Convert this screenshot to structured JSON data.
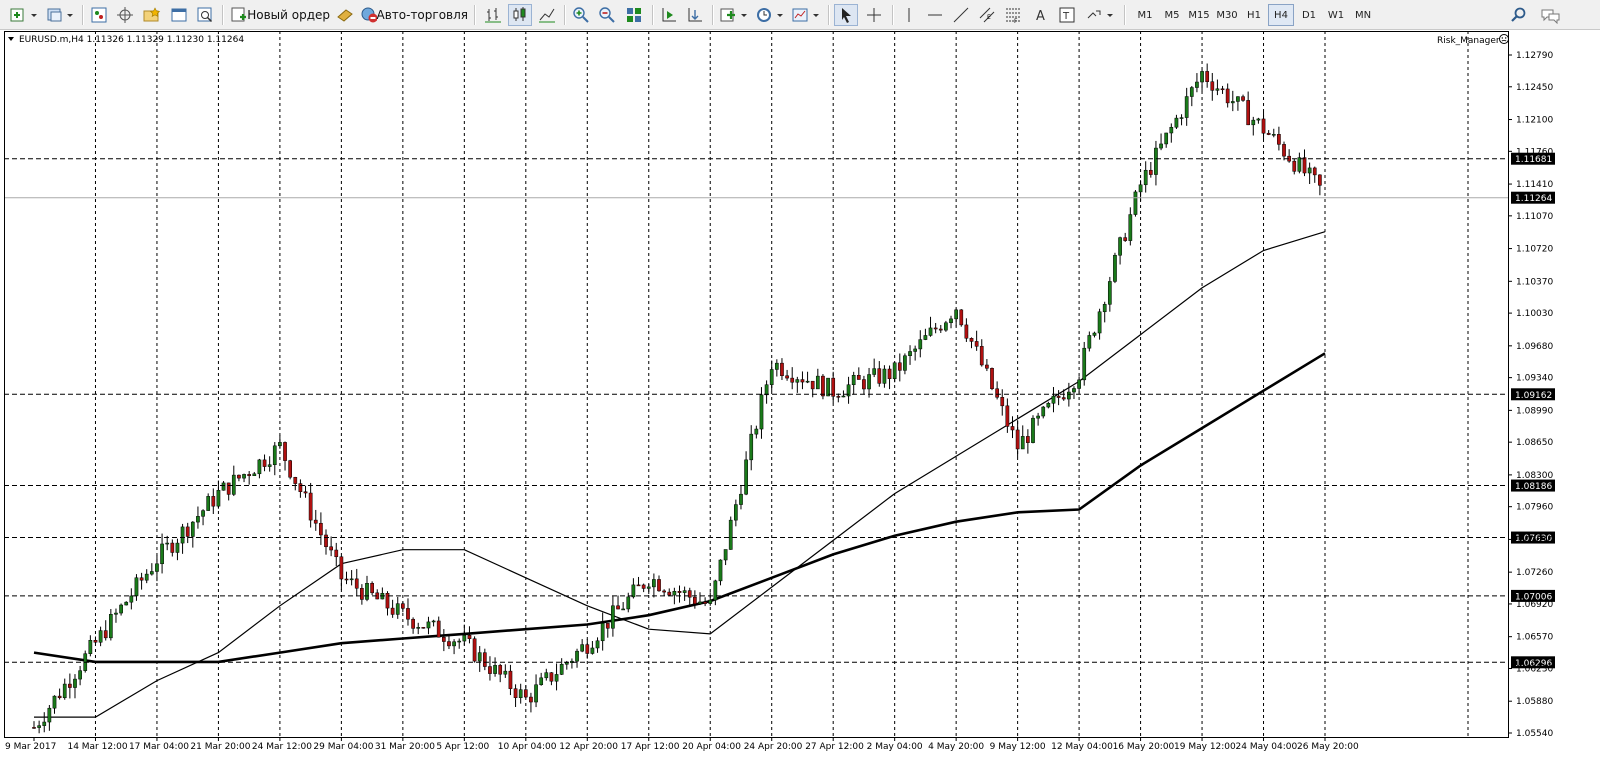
{
  "toolbar": {
    "new_order_label": "Новый ордер",
    "autotrading_label": "Авто-торговля",
    "timeframes": [
      "M1",
      "M5",
      "M15",
      "M30",
      "H1",
      "H4",
      "D1",
      "W1",
      "MN"
    ],
    "active_timeframe": "H4"
  },
  "chart": {
    "header": "EURUSD.m,H4  1.11326 1.11329 1.11230 1.11264",
    "indicator_label": "Risk_Manager",
    "price_ticks": [
      "1.12790",
      "1.12450",
      "1.12100",
      "1.11760",
      "1.11410",
      "1.11070",
      "1.10720",
      "1.10370",
      "1.10030",
      "1.09680",
      "1.09340",
      "1.08990",
      "1.08650",
      "1.08300",
      "1.07960",
      "1.07610",
      "1.07260",
      "1.06920",
      "1.06570",
      "1.06230",
      "1.05880",
      "1.05540"
    ],
    "time_labels": [
      "9 Mar 2017",
      "14 Mar 12:00",
      "17 Mar 04:00",
      "21 Mar 20:00",
      "24 Mar 12:00",
      "29 Mar 04:00",
      "31 Mar 20:00",
      "5 Apr 12:00",
      "10 Apr 04:00",
      "12 Apr 20:00",
      "17 Apr 12:00",
      "20 Apr 04:00",
      "24 Apr 20:00",
      "27 Apr 12:00",
      "2 May 04:00",
      "4 May 20:00",
      "9 May 12:00",
      "12 May 04:00",
      "16 May 20:00",
      "19 May 12:00",
      "24 May 04:00",
      "26 May 20:00"
    ],
    "levels": [
      {
        "label": "1.11681",
        "value": 1.11681
      },
      {
        "label": "1.09162",
        "value": 1.09162
      },
      {
        "label": "1.08186",
        "value": 1.08186
      },
      {
        "label": "1.07630",
        "value": 1.0763
      },
      {
        "label": "1.07006",
        "value": 1.07006
      },
      {
        "label": "1.06296",
        "value": 1.06296
      }
    ],
    "bid": {
      "label": "1.11264",
      "value": 1.11264
    },
    "colors": {
      "bull": "#1a7a1a",
      "bear": "#b01010",
      "line": "#000000"
    }
  },
  "chart_data": {
    "type": "line",
    "title": "EURUSD.m,H4",
    "ylim": [
      1.0554,
      1.1284
    ],
    "x": [
      "9 Mar 2017",
      "14 Mar 12:00",
      "17 Mar 04:00",
      "21 Mar 20:00",
      "24 Mar 12:00",
      "29 Mar 04:00",
      "31 Mar 20:00",
      "5 Apr 12:00",
      "10 Apr 04:00",
      "12 Apr 20:00",
      "17 Apr 12:00",
      "20 Apr 04:00",
      "24 Apr 20:00",
      "27 Apr 12:00",
      "2 May 04:00",
      "4 May 20:00",
      "9 May 12:00",
      "12 May 04:00",
      "16 May 20:00",
      "19 May 12:00",
      "24 May 04:00",
      "26 May 20:00"
    ],
    "series": [
      {
        "name": "EURUSD.m",
        "values": [
          1.056,
          1.065,
          1.074,
          1.081,
          1.086,
          1.072,
          1.068,
          1.065,
          1.059,
          1.065,
          1.072,
          1.069,
          1.095,
          1.092,
          1.094,
          1.101,
          1.086,
          1.094,
          1.114,
          1.126,
          1.12,
          1.113
        ]
      },
      {
        "values": [
          1.0571,
          1.0571,
          1.061,
          1.064,
          1.069,
          1.0735,
          1.075,
          1.075,
          1.072,
          1.069,
          1.0665,
          1.066,
          1.071,
          1.076,
          1.081,
          1.085,
          1.089,
          1.093,
          1.098,
          1.103,
          1.107,
          1.109
        ]
      },
      {
        "values": [
          1.064,
          1.063,
          1.063,
          1.063,
          1.064,
          1.065,
          1.0655,
          1.066,
          1.0665,
          1.067,
          1.068,
          1.0695,
          1.072,
          1.0745,
          1.0765,
          1.078,
          1.079,
          1.0793,
          1.084,
          1.088,
          1.092,
          1.096
        ]
      }
    ]
  }
}
